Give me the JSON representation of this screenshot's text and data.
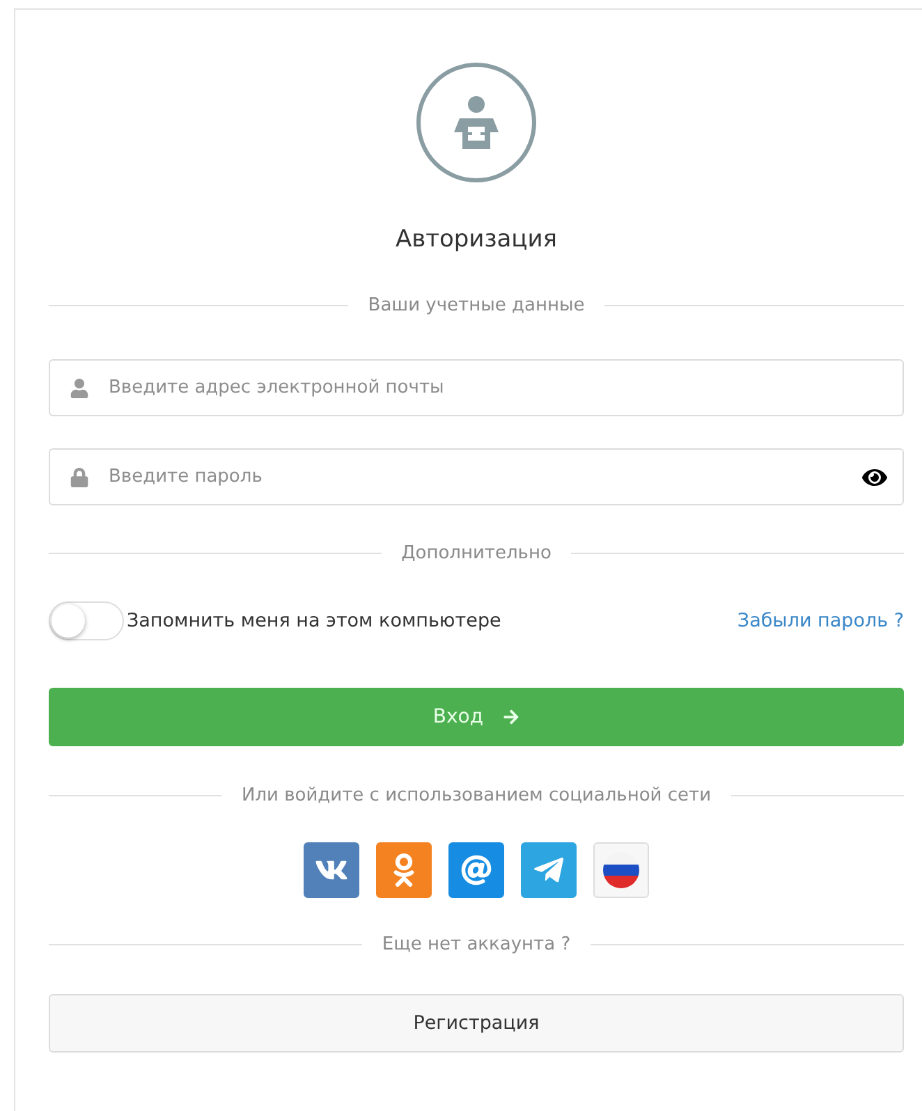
{
  "title": "Авторизация",
  "credentials_divider": "Ваши учетные данные",
  "email_field": {
    "placeholder": "Введите адрес электронной почты"
  },
  "password_field": {
    "placeholder": "Введите пароль"
  },
  "extra_divider": "Дополнительно",
  "remember": {
    "label": "Запомнить меня на этом компьютере",
    "checked": false
  },
  "forgot_link": "Забыли пароль ?",
  "login_button": "Вход",
  "social_divider": "Или войдите с использованием социальной сети",
  "social_buttons": [
    {
      "kind": "vk",
      "color": "#5181b8"
    },
    {
      "kind": "ok",
      "color": "#f58220"
    },
    {
      "kind": "mail",
      "color": "#168de2"
    },
    {
      "kind": "telegram",
      "color": "#2ca5e0"
    },
    {
      "kind": "flag",
      "color": "#f7f7f7"
    }
  ],
  "signup_divider": "Еще нет аккаунта ?",
  "register_button": "Регистрация"
}
